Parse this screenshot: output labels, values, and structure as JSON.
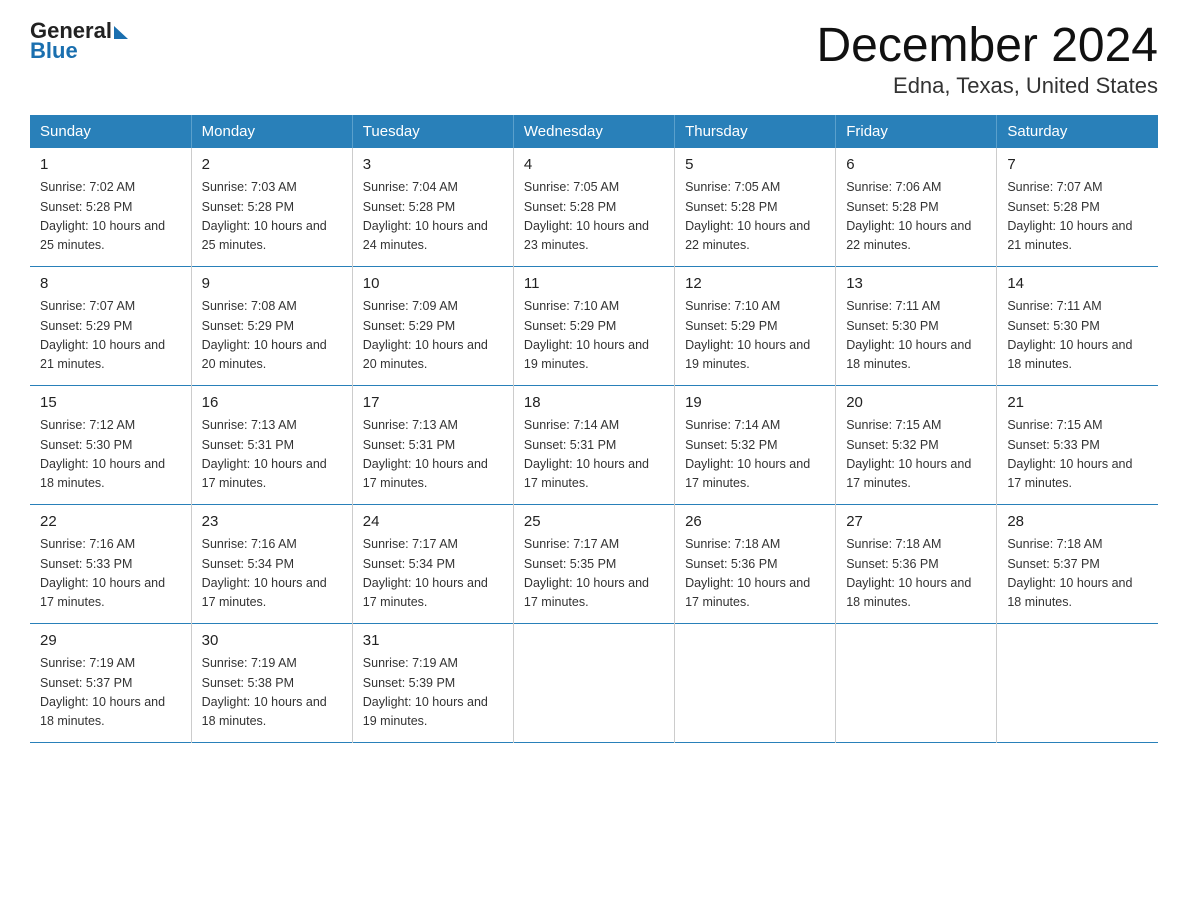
{
  "logo": {
    "general": "General",
    "blue": "Blue"
  },
  "title": "December 2024",
  "subtitle": "Edna, Texas, United States",
  "days_of_week": [
    "Sunday",
    "Monday",
    "Tuesday",
    "Wednesday",
    "Thursday",
    "Friday",
    "Saturday"
  ],
  "weeks": [
    [
      {
        "day": "1",
        "sunrise": "7:02 AM",
        "sunset": "5:28 PM",
        "daylight": "10 hours and 25 minutes."
      },
      {
        "day": "2",
        "sunrise": "7:03 AM",
        "sunset": "5:28 PM",
        "daylight": "10 hours and 25 minutes."
      },
      {
        "day": "3",
        "sunrise": "7:04 AM",
        "sunset": "5:28 PM",
        "daylight": "10 hours and 24 minutes."
      },
      {
        "day": "4",
        "sunrise": "7:05 AM",
        "sunset": "5:28 PM",
        "daylight": "10 hours and 23 minutes."
      },
      {
        "day": "5",
        "sunrise": "7:05 AM",
        "sunset": "5:28 PM",
        "daylight": "10 hours and 22 minutes."
      },
      {
        "day": "6",
        "sunrise": "7:06 AM",
        "sunset": "5:28 PM",
        "daylight": "10 hours and 22 minutes."
      },
      {
        "day": "7",
        "sunrise": "7:07 AM",
        "sunset": "5:28 PM",
        "daylight": "10 hours and 21 minutes."
      }
    ],
    [
      {
        "day": "8",
        "sunrise": "7:07 AM",
        "sunset": "5:29 PM",
        "daylight": "10 hours and 21 minutes."
      },
      {
        "day": "9",
        "sunrise": "7:08 AM",
        "sunset": "5:29 PM",
        "daylight": "10 hours and 20 minutes."
      },
      {
        "day": "10",
        "sunrise": "7:09 AM",
        "sunset": "5:29 PM",
        "daylight": "10 hours and 20 minutes."
      },
      {
        "day": "11",
        "sunrise": "7:10 AM",
        "sunset": "5:29 PM",
        "daylight": "10 hours and 19 minutes."
      },
      {
        "day": "12",
        "sunrise": "7:10 AM",
        "sunset": "5:29 PM",
        "daylight": "10 hours and 19 minutes."
      },
      {
        "day": "13",
        "sunrise": "7:11 AM",
        "sunset": "5:30 PM",
        "daylight": "10 hours and 18 minutes."
      },
      {
        "day": "14",
        "sunrise": "7:11 AM",
        "sunset": "5:30 PM",
        "daylight": "10 hours and 18 minutes."
      }
    ],
    [
      {
        "day": "15",
        "sunrise": "7:12 AM",
        "sunset": "5:30 PM",
        "daylight": "10 hours and 18 minutes."
      },
      {
        "day": "16",
        "sunrise": "7:13 AM",
        "sunset": "5:31 PM",
        "daylight": "10 hours and 17 minutes."
      },
      {
        "day": "17",
        "sunrise": "7:13 AM",
        "sunset": "5:31 PM",
        "daylight": "10 hours and 17 minutes."
      },
      {
        "day": "18",
        "sunrise": "7:14 AM",
        "sunset": "5:31 PM",
        "daylight": "10 hours and 17 minutes."
      },
      {
        "day": "19",
        "sunrise": "7:14 AM",
        "sunset": "5:32 PM",
        "daylight": "10 hours and 17 minutes."
      },
      {
        "day": "20",
        "sunrise": "7:15 AM",
        "sunset": "5:32 PM",
        "daylight": "10 hours and 17 minutes."
      },
      {
        "day": "21",
        "sunrise": "7:15 AM",
        "sunset": "5:33 PM",
        "daylight": "10 hours and 17 minutes."
      }
    ],
    [
      {
        "day": "22",
        "sunrise": "7:16 AM",
        "sunset": "5:33 PM",
        "daylight": "10 hours and 17 minutes."
      },
      {
        "day": "23",
        "sunrise": "7:16 AM",
        "sunset": "5:34 PM",
        "daylight": "10 hours and 17 minutes."
      },
      {
        "day": "24",
        "sunrise": "7:17 AM",
        "sunset": "5:34 PM",
        "daylight": "10 hours and 17 minutes."
      },
      {
        "day": "25",
        "sunrise": "7:17 AM",
        "sunset": "5:35 PM",
        "daylight": "10 hours and 17 minutes."
      },
      {
        "day": "26",
        "sunrise": "7:18 AM",
        "sunset": "5:36 PM",
        "daylight": "10 hours and 17 minutes."
      },
      {
        "day": "27",
        "sunrise": "7:18 AM",
        "sunset": "5:36 PM",
        "daylight": "10 hours and 18 minutes."
      },
      {
        "day": "28",
        "sunrise": "7:18 AM",
        "sunset": "5:37 PM",
        "daylight": "10 hours and 18 minutes."
      }
    ],
    [
      {
        "day": "29",
        "sunrise": "7:19 AM",
        "sunset": "5:37 PM",
        "daylight": "10 hours and 18 minutes."
      },
      {
        "day": "30",
        "sunrise": "7:19 AM",
        "sunset": "5:38 PM",
        "daylight": "10 hours and 18 minutes."
      },
      {
        "day": "31",
        "sunrise": "7:19 AM",
        "sunset": "5:39 PM",
        "daylight": "10 hours and 19 minutes."
      },
      null,
      null,
      null,
      null
    ]
  ]
}
